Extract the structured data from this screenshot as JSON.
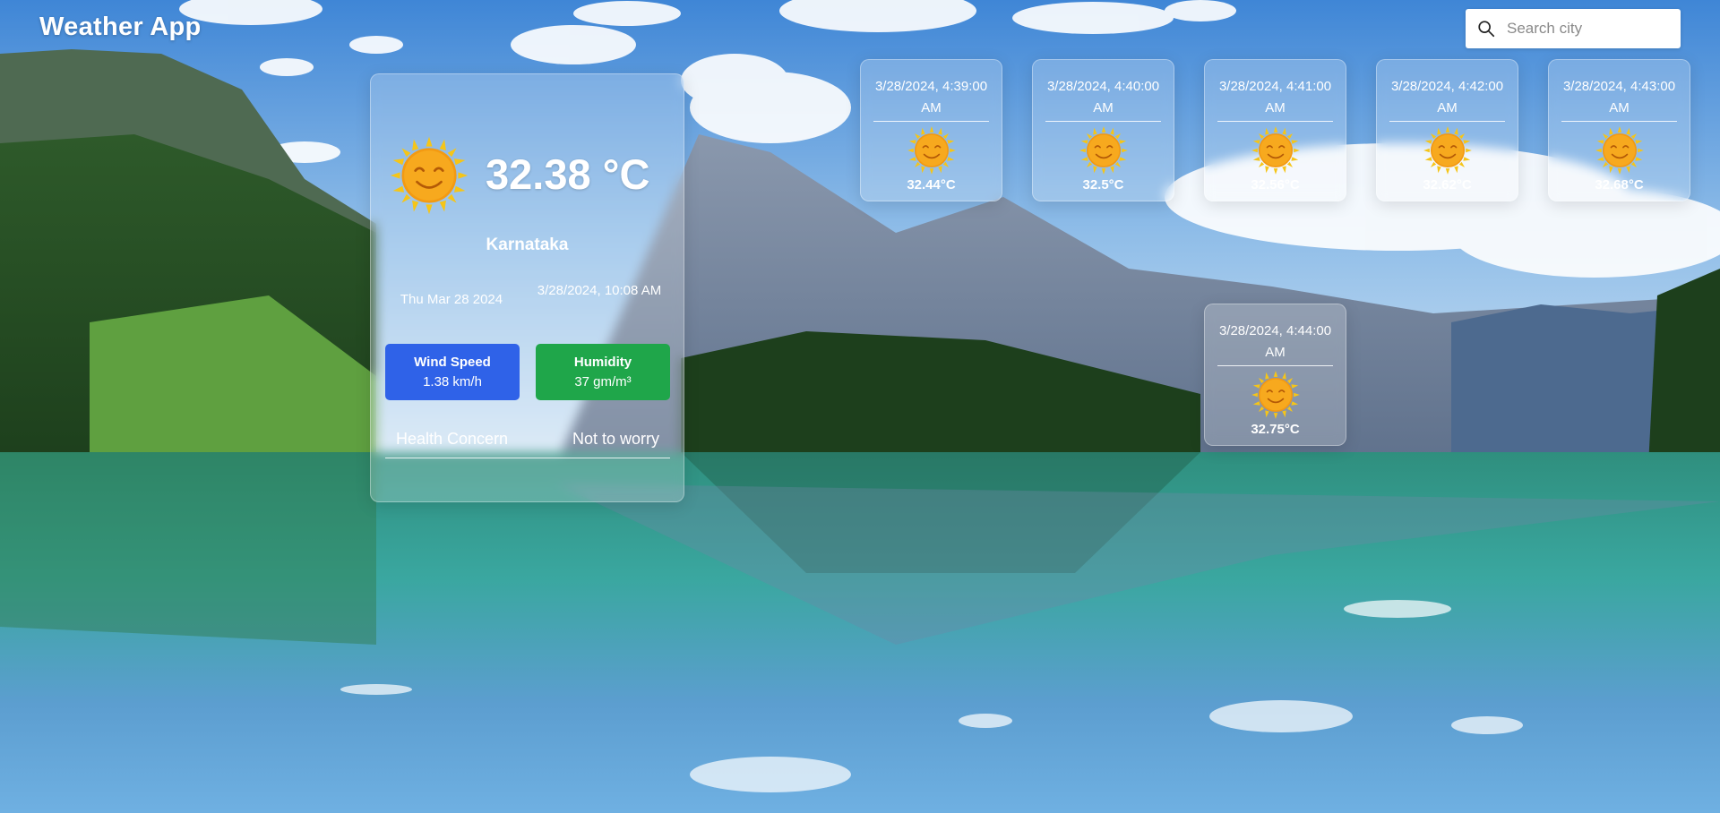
{
  "app": {
    "title": "Weather App"
  },
  "search": {
    "placeholder": "Search city",
    "value": "",
    "icon": "search-icon"
  },
  "current": {
    "icon": "sun-icon",
    "temperature": "32.38 °C",
    "location": "Karnataka",
    "date": "Thu Mar 28 2024",
    "datetime": "3/28/2024, 10:08 AM",
    "wind": {
      "label": "Wind Speed",
      "value": "1.38 km/h",
      "color": "#2f62e8"
    },
    "humidity": {
      "label": "Humidity",
      "value": "37 gm/m³",
      "color": "#1fa64a"
    },
    "health": {
      "label": "Health Concern",
      "value": "Not to worry"
    }
  },
  "forecast": [
    {
      "time": "3/28/2024, 4:39:00 AM",
      "temp": "32.44°C",
      "icon": "sun-icon"
    },
    {
      "time": "3/28/2024, 4:40:00 AM",
      "temp": "32.5°C",
      "icon": "sun-icon"
    },
    {
      "time": "3/28/2024, 4:41:00 AM",
      "temp": "32.56°C",
      "icon": "sun-icon"
    },
    {
      "time": "3/28/2024, 4:42:00 AM",
      "temp": "32.62°C",
      "icon": "sun-icon"
    },
    {
      "time": "3/28/2024, 4:43:00 AM",
      "temp": "32.68°C",
      "icon": "sun-icon"
    },
    {
      "time": "3/28/2024, 4:44:00 AM",
      "temp": "32.75°C",
      "icon": "sun-icon"
    }
  ]
}
